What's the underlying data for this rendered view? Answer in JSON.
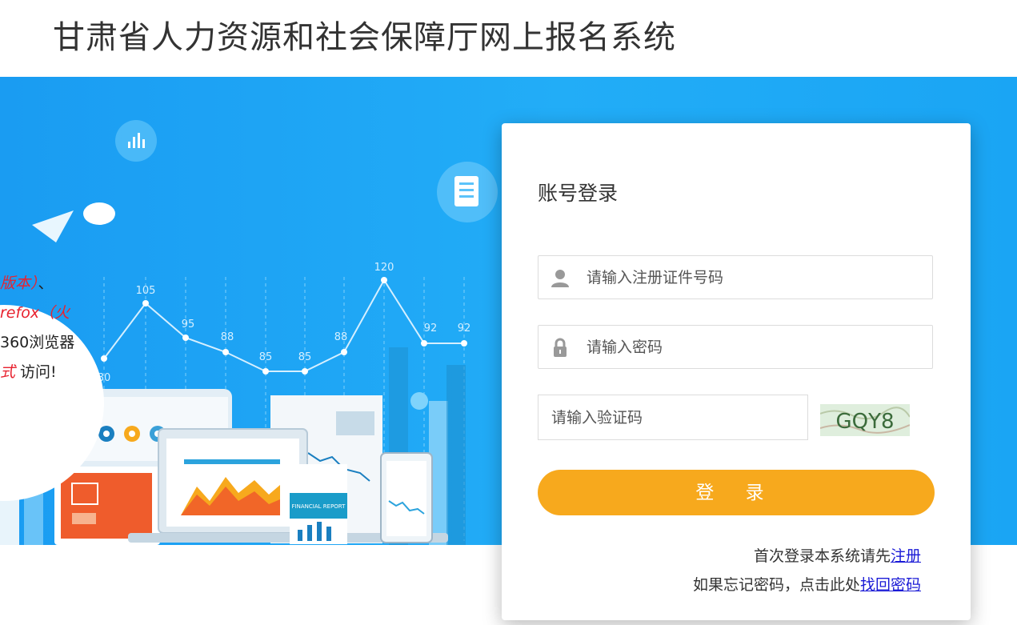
{
  "header": {
    "title": "甘肃省人力资源和社会保障厅网上报名系统"
  },
  "banner": {
    "tip_lines": [
      {
        "red": "版本）",
        "dark": "、"
      },
      {
        "red": "refox（火",
        "dark": ""
      },
      {
        "red": "",
        "dark": "360浏览器"
      },
      {
        "red": "式",
        "dark": " 访问!"
      }
    ],
    "chart_labels": [
      "80",
      "105",
      "95",
      "88",
      "85",
      "85",
      "88",
      "120",
      "92",
      "92"
    ],
    "report_label": "FINANCIAL REPORT"
  },
  "login": {
    "title": "账号登录",
    "id_placeholder": "请输入注册证件号码",
    "password_placeholder": "请输入密码",
    "captcha_placeholder": "请输入验证码",
    "captcha_text": "GQY8",
    "submit_label": "登 录",
    "register_hint": "首次登录本系统请先",
    "register_link": "注册",
    "forgot_hint": "如果忘记密码，点击此处",
    "forgot_link": "找回密码"
  },
  "colors": {
    "banner": "#22adf7",
    "accent": "#f7a91d",
    "link": "#1a1ad6"
  }
}
